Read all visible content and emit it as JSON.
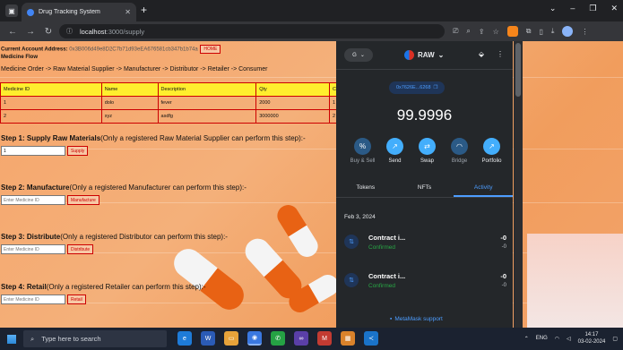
{
  "browser": {
    "tab_title": "Drug Tracking System",
    "url_host": "localhost",
    "url_path": ":3000/supply"
  },
  "page": {
    "account_label": "Current Account Address:",
    "account_address": "0x3B006d49e8D2C7b71d93eEA676581cb347b1b74a",
    "home_label": "HOME",
    "flow_title": "Medicine Flow",
    "flow_text": "Medicine Order -> Raw Material Supplier -> Manufacturer -> Distributor -> Retailer -> Consumer",
    "table": {
      "headers": [
        "Medicine ID",
        "Name",
        "Description",
        "Qty",
        "C"
      ],
      "rows": [
        [
          "1",
          "dolo",
          "fever",
          "2000",
          "1"
        ],
        [
          "2",
          "xyz",
          "asdfg",
          "3000000",
          "2"
        ]
      ]
    },
    "steps": [
      {
        "title": "Step 1: Supply Raw Materials",
        "note": "(Only a registered Raw Material Supplier can perform this step):-",
        "input_value": "1",
        "placeholder": "Enter Medicine ID",
        "button": "Supply"
      },
      {
        "title": "Step 2: Manufacture",
        "note": "(Only a registered Manufacturer can perform this step):-",
        "input_value": "",
        "placeholder": "Enter Medicine ID",
        "button": "Manufacture"
      },
      {
        "title": "Step 3: Distribute",
        "note": "(Only a registered Distributor can perform this step):-",
        "input_value": "",
        "placeholder": "Enter Medicine ID",
        "button": "Distribute"
      },
      {
        "title": "Step 4: Retail",
        "note": "(Only a registered Retailer can perform this step):-",
        "input_value": "",
        "placeholder": "Enter Medicine ID",
        "button": "Retail"
      }
    ]
  },
  "metamask": {
    "network_letter": "G",
    "account_name": "RAW",
    "address_short": "0x7626E...6268",
    "balance": "99.9996",
    "actions": [
      {
        "label": "Buy & Sell",
        "icon": "%",
        "disabled": true
      },
      {
        "label": "Send",
        "icon": "↗",
        "disabled": false
      },
      {
        "label": "Swap",
        "icon": "⇄",
        "disabled": false
      },
      {
        "label": "Bridge",
        "icon": "◠",
        "disabled": true
      },
      {
        "label": "Portfolio",
        "icon": "↗",
        "disabled": false
      }
    ],
    "tabs": [
      "Tokens",
      "NFTs",
      "Activity"
    ],
    "active_tab": "Activity",
    "date": "Feb 3, 2024",
    "transactions": [
      {
        "title": "Contract i...",
        "status": "Confirmed",
        "amount": "-0",
        "amount_secondary": "-0"
      },
      {
        "title": "Contract i...",
        "status": "Confirmed",
        "amount": "-0",
        "amount_secondary": "-0"
      }
    ],
    "support": "MetaMask support",
    "accent": "#4d9dff"
  },
  "taskbar": {
    "search_placeholder": "Type here to search",
    "language": "ENG",
    "time": "14:17",
    "date": "03-02-2024"
  }
}
